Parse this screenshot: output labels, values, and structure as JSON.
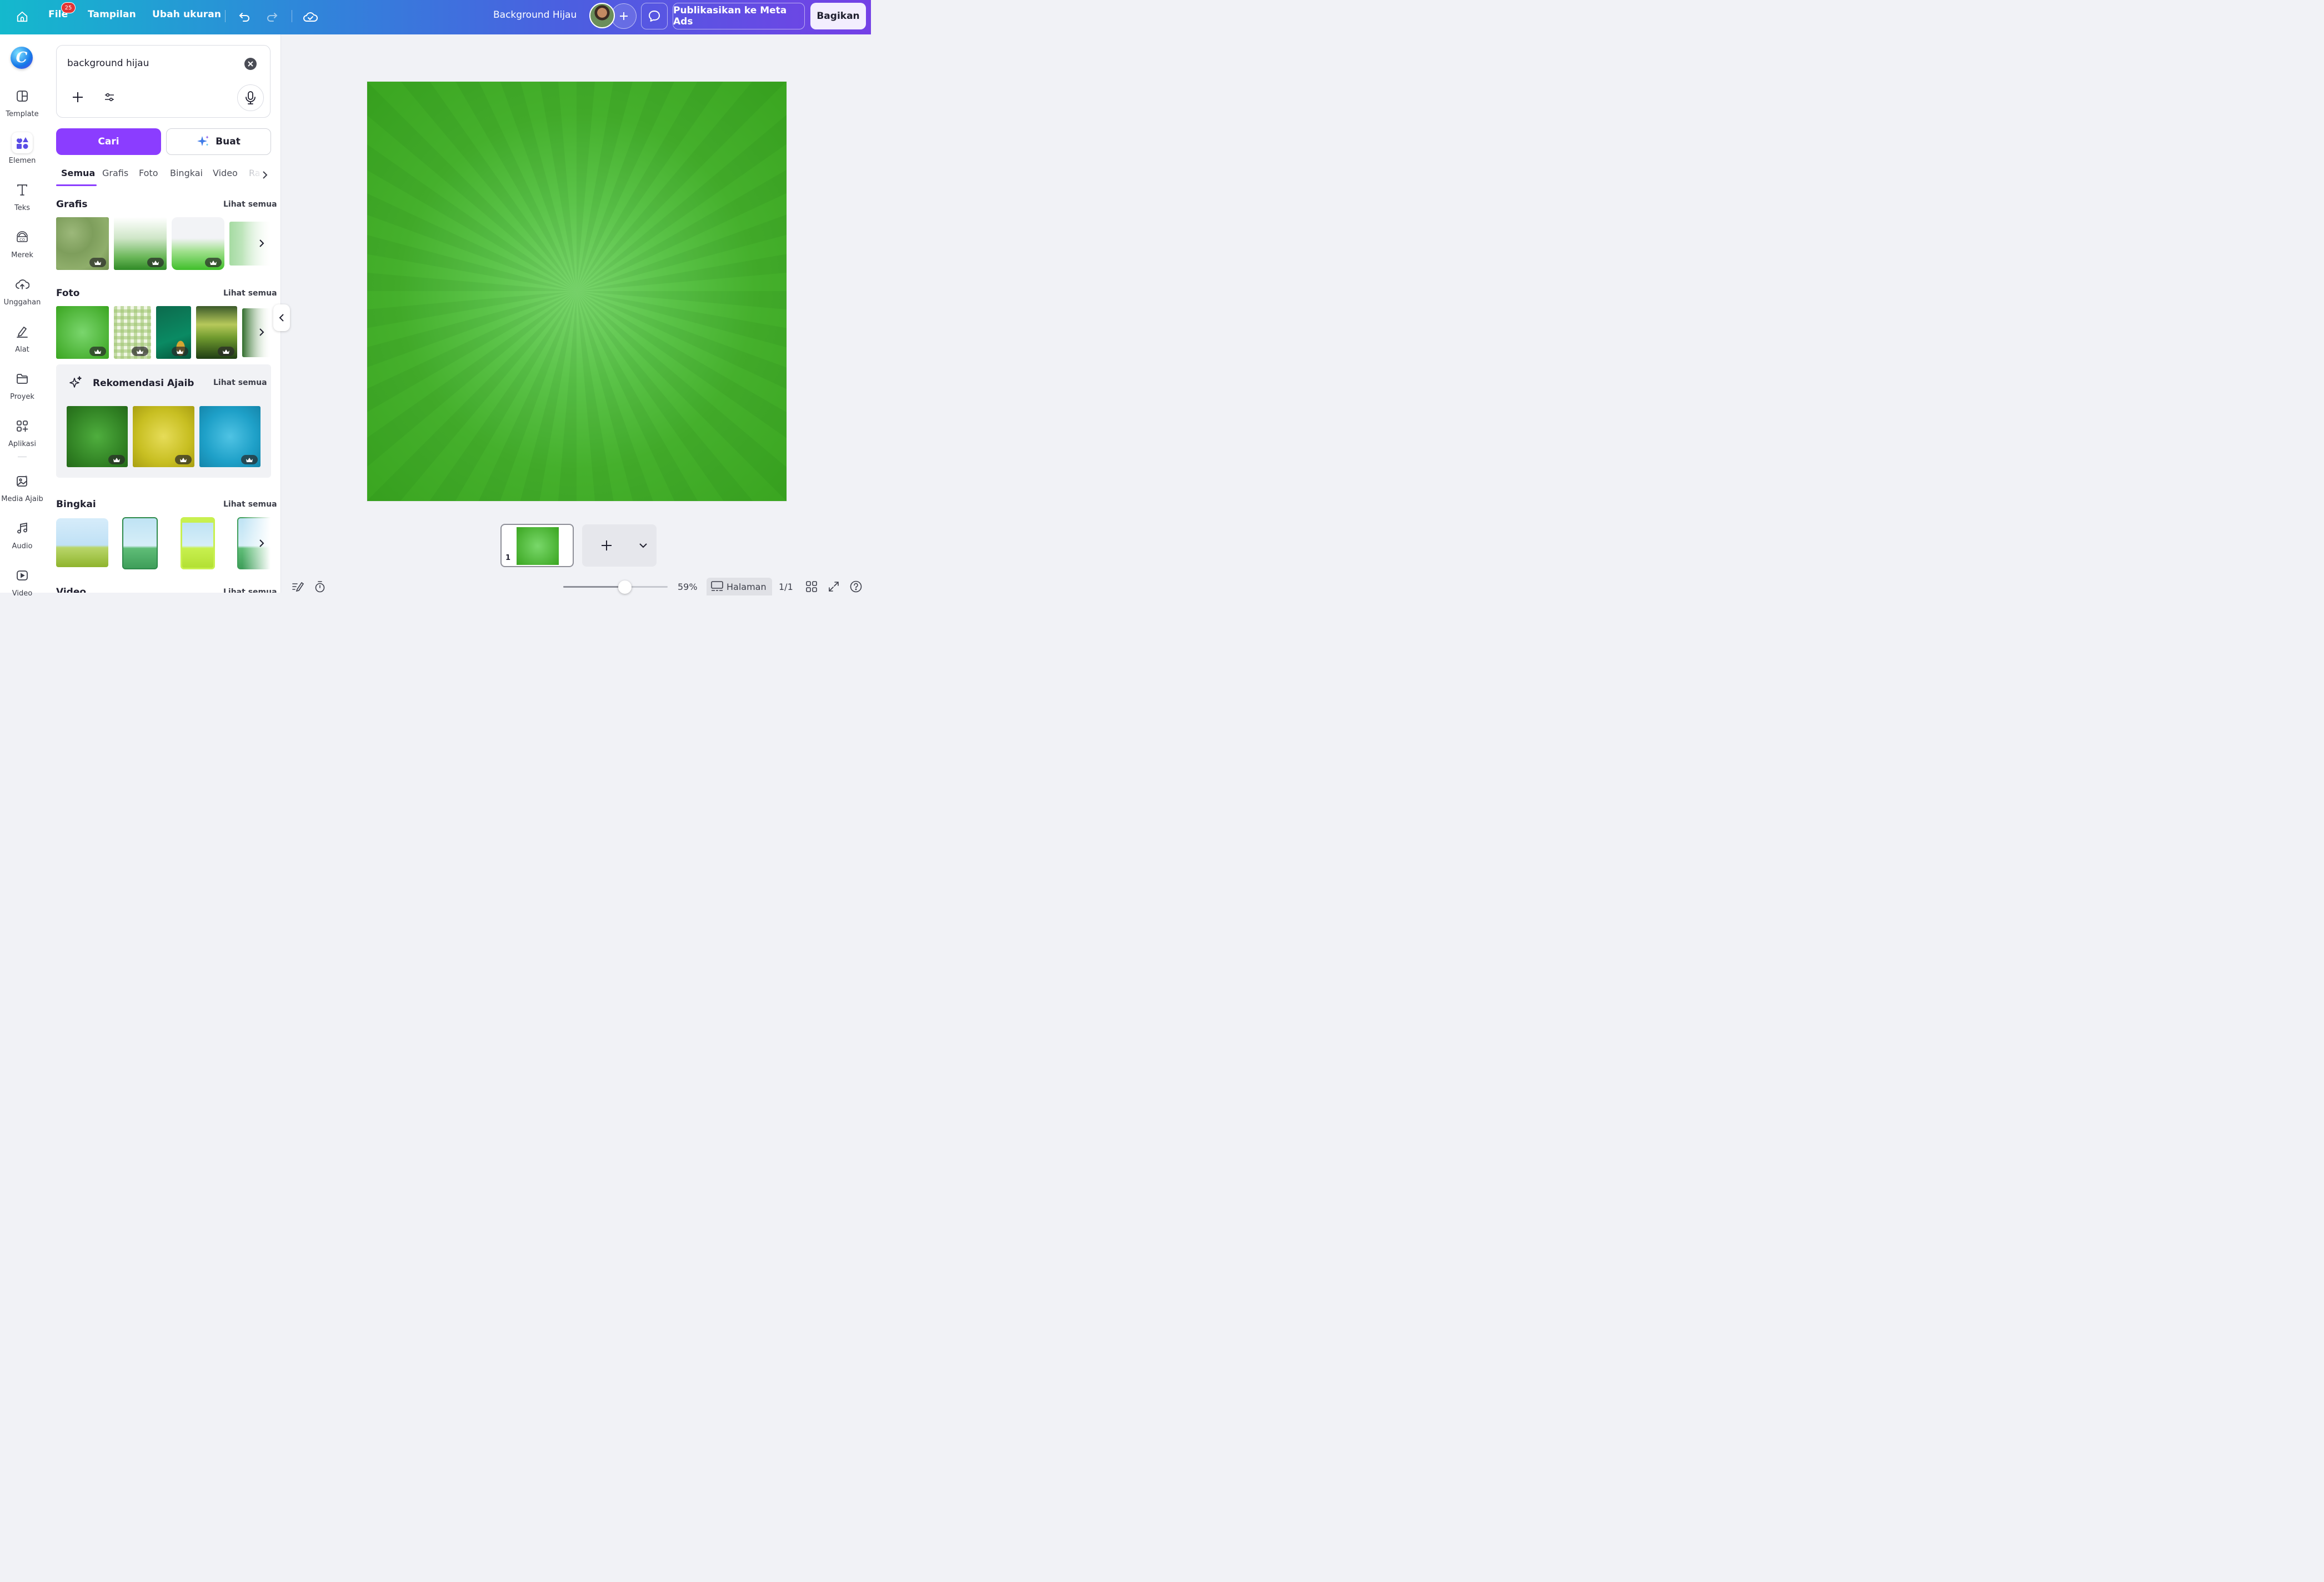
{
  "topbar": {
    "file_label": "File",
    "file_badge": "25",
    "view_label": "Tampilan",
    "resize_label": "Ubah ukuran",
    "doc_title": "Background Hijau",
    "publish_label": "Publikasikan ke Meta Ads",
    "share_label": "Bagikan"
  },
  "rail": {
    "items": [
      {
        "label": "Template",
        "icon": "template-icon"
      },
      {
        "label": "Elemen",
        "icon": "elements-icon"
      },
      {
        "label": "Teks",
        "icon": "text-icon"
      },
      {
        "label": "Merek",
        "icon": "brand-icon"
      },
      {
        "label": "Unggahan",
        "icon": "upload-icon"
      },
      {
        "label": "Alat",
        "icon": "draw-tool-icon"
      },
      {
        "label": "Proyek",
        "icon": "folder-icon"
      },
      {
        "label": "Aplikasi",
        "icon": "apps-icon"
      },
      {
        "label": "Media Ajaib",
        "icon": "magic-media-icon"
      },
      {
        "label": "Audio",
        "icon": "music-icon"
      },
      {
        "label": "Video",
        "icon": "video-icon"
      }
    ]
  },
  "panel": {
    "search_value": "background hijau",
    "search_button": "Cari",
    "create_button": "Buat",
    "tabs": [
      "Semua",
      "Grafis",
      "Foto",
      "Bingkai",
      "Video",
      "Ra"
    ],
    "sections": {
      "graphics": {
        "title": "Grafis",
        "see_all": "Lihat semua"
      },
      "photos": {
        "title": "Foto",
        "see_all": "Lihat semua"
      },
      "magic": {
        "title": "Rekomendasi Ajaib",
        "see_all": "Lihat semua"
      },
      "frames": {
        "title": "Bingkai",
        "see_all": "Lihat semua"
      },
      "videos": {
        "title": "Video",
        "see_all": "Lihat semua"
      }
    }
  },
  "canvas": {
    "page_number": "1",
    "zoom": "59%",
    "pages_label": "Halaman",
    "page_count": "1/1",
    "zoom_level": 0.59
  },
  "colors": {
    "accent": "#8b3dff",
    "canvas_green": "#45b02c"
  }
}
